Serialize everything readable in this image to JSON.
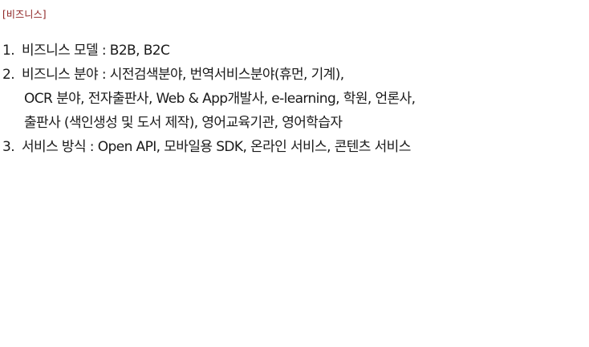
{
  "section": {
    "heading": "[비즈니스]"
  },
  "items": [
    {
      "number": "1.",
      "lines": [
        "비즈니스 모델 : B2B, B2C"
      ]
    },
    {
      "number": "2.",
      "lines": [
        "비즈니스 분야 : 시전검색분야, 번역서비스분야(휴먼, 기계),",
        "OCR 분야, 전자출판사, Web & App개발사, e-learning, 학원, 언론사,",
        "출판사 (색인생성 및 도서 제작), 영어교육기관, 영어학습자"
      ]
    },
    {
      "number": "3.",
      "lines": [
        "서비스 방식 : Open API, 모바일용 SDK, 온라인 서비스, 콘텐츠 서비스"
      ]
    }
  ],
  "colors": {
    "heading": "#8b1d1d",
    "text": "#1a1a1a",
    "background": "#ffffff"
  }
}
